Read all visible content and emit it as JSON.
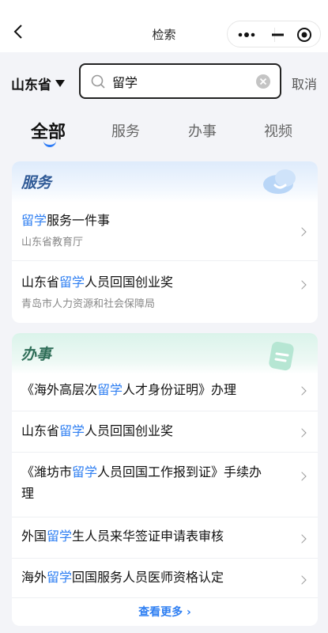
{
  "nav": {
    "title": "检索"
  },
  "search": {
    "province": "山东省",
    "query": "留学",
    "placeholder": "",
    "cancel_label": "取消"
  },
  "tabs": [
    {
      "label": "全部",
      "active": true
    },
    {
      "label": "服务",
      "active": false
    },
    {
      "label": "办事",
      "active": false
    },
    {
      "label": "视频",
      "active": false
    }
  ],
  "service_section": {
    "title": "服务",
    "items": [
      {
        "pre": "",
        "hl": "留学",
        "post": "服务一件事",
        "sub": "山东省教育厅"
      },
      {
        "pre": "山东省",
        "hl": "留学",
        "post": "人员回国创业奖",
        "sub": "青岛市人力资源和社会保障局"
      }
    ]
  },
  "affair_section": {
    "title": "办事",
    "items": [
      {
        "pre": "《海外高层次",
        "hl": "留学",
        "post": "人才身份证明》办理",
        "line2": ""
      },
      {
        "pre": "山东省",
        "hl": "留学",
        "post": "人员回国创业奖",
        "line2": ""
      },
      {
        "pre": "《潍坊市",
        "hl": "留学",
        "post": "人员回国工作报到证》手续办",
        "line2": "理"
      },
      {
        "pre": "外国",
        "hl": "留学",
        "post": "生人员来华签证申请表审核",
        "line2": ""
      },
      {
        "pre": "海外",
        "hl": "留学",
        "post": "回国服务人员医师资格认定",
        "line2": ""
      }
    ],
    "more_label": "查看更多"
  },
  "colors": {
    "accent": "#2f7ff2",
    "service_title": "#2f5a96",
    "affair_title": "#2f6e58"
  }
}
